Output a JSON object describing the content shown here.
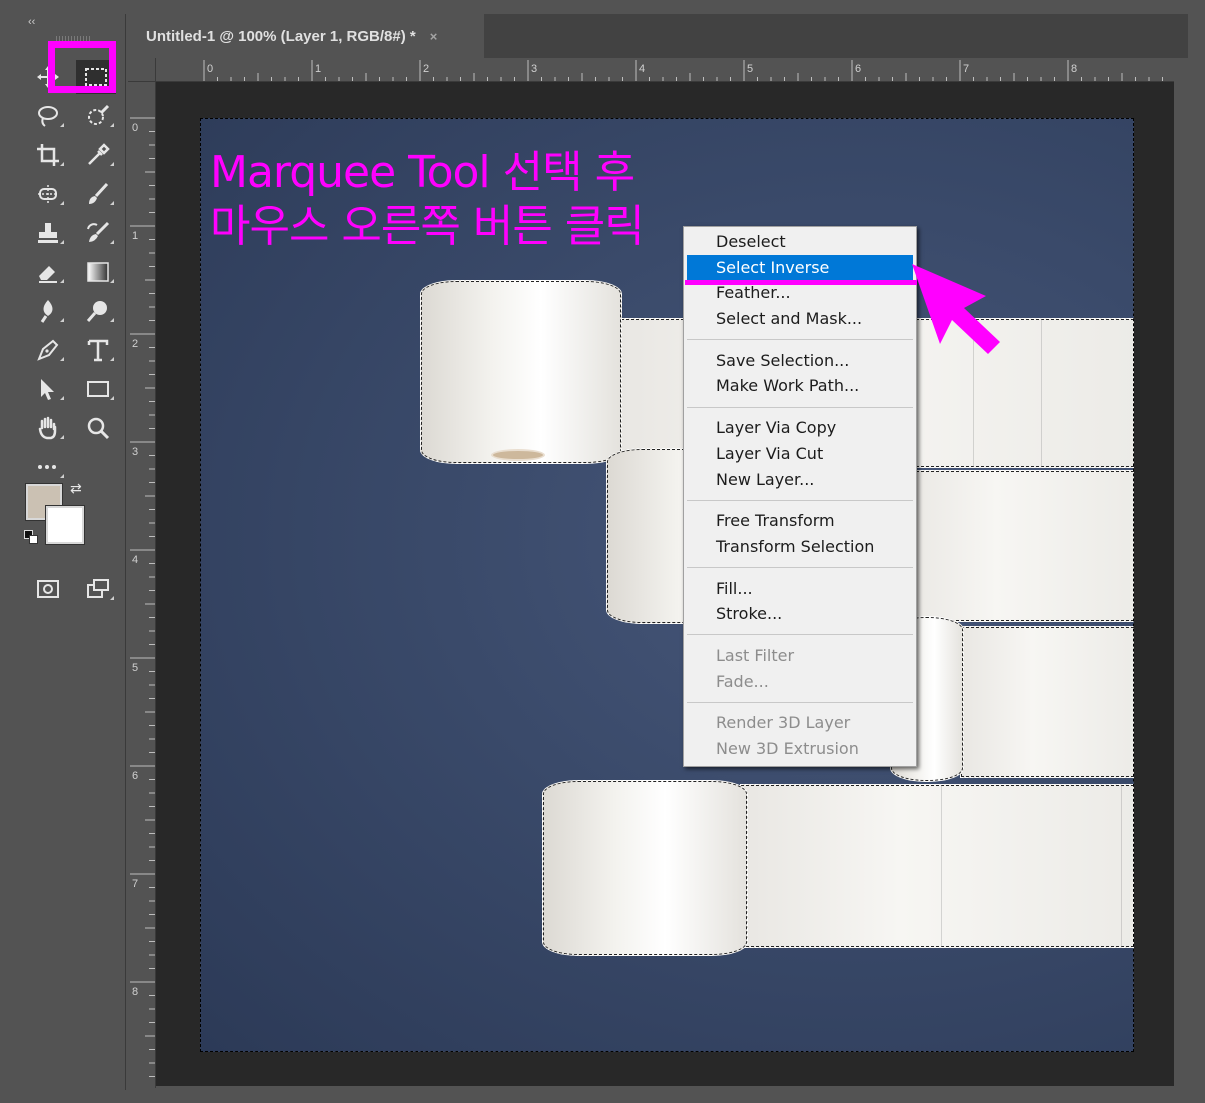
{
  "document": {
    "tab_title": "Untitled-1 @ 100% (Layer 1, RGB/8#) *",
    "close_glyph": "×"
  },
  "toolbar": {
    "collapse_glyph": "‹‹",
    "swap_glyph": "⇄",
    "tools": [
      {
        "name": "move-tool-icon"
      },
      {
        "name": "rectangular-marquee-tool-icon",
        "selected": true
      },
      {
        "name": "lasso-tool-icon"
      },
      {
        "name": "quick-selection-tool-icon"
      },
      {
        "name": "crop-tool-icon"
      },
      {
        "name": "eyedropper-tool-icon"
      },
      {
        "name": "spot-healing-tool-icon"
      },
      {
        "name": "brush-tool-icon"
      },
      {
        "name": "clone-stamp-tool-icon"
      },
      {
        "name": "history-brush-tool-icon"
      },
      {
        "name": "eraser-tool-icon"
      },
      {
        "name": "gradient-tool-icon"
      },
      {
        "name": "blur-tool-icon"
      },
      {
        "name": "dodge-tool-icon"
      },
      {
        "name": "pen-tool-icon"
      },
      {
        "name": "type-tool-icon"
      },
      {
        "name": "path-selection-tool-icon"
      },
      {
        "name": "rectangle-tool-icon"
      },
      {
        "name": "hand-tool-icon"
      },
      {
        "name": "zoom-tool-icon"
      },
      {
        "name": "more-tools-icon"
      }
    ],
    "foreground_color": "#cbc1b3",
    "background_color": "#ffffff"
  },
  "rulers": {
    "horizontal": [
      "0",
      "1",
      "2",
      "3",
      "4",
      "5",
      "6",
      "7",
      "8"
    ],
    "vertical": [
      "0",
      "1",
      "2",
      "3",
      "4",
      "5",
      "6",
      "7",
      "8"
    ]
  },
  "annotation": {
    "line1": "Marquee Tool 선택 후",
    "line2": "마우스 오른쪽 버튼 클릭",
    "color": "#ff00ff"
  },
  "context_menu": {
    "groups": [
      [
        {
          "label": "Deselect",
          "enabled": true
        },
        {
          "label": "Select Inverse",
          "enabled": true,
          "highlighted": true
        },
        {
          "label": "Feather...",
          "enabled": true
        },
        {
          "label": "Select and Mask...",
          "enabled": true
        }
      ],
      [
        {
          "label": "Save Selection...",
          "enabled": true
        },
        {
          "label": "Make Work Path...",
          "enabled": true
        }
      ],
      [
        {
          "label": "Layer Via Copy",
          "enabled": true
        },
        {
          "label": "Layer Via Cut",
          "enabled": true
        },
        {
          "label": "New Layer...",
          "enabled": true
        }
      ],
      [
        {
          "label": "Free Transform",
          "enabled": true
        },
        {
          "label": "Transform Selection",
          "enabled": true
        }
      ],
      [
        {
          "label": "Fill...",
          "enabled": true
        },
        {
          "label": "Stroke...",
          "enabled": true
        }
      ],
      [
        {
          "label": "Last Filter",
          "enabled": false
        },
        {
          "label": "Fade...",
          "enabled": false
        }
      ],
      [
        {
          "label": "Render 3D Layer",
          "enabled": false
        },
        {
          "label": "New 3D Extrusion",
          "enabled": false
        }
      ]
    ],
    "highlight_color": "#0078d7"
  }
}
